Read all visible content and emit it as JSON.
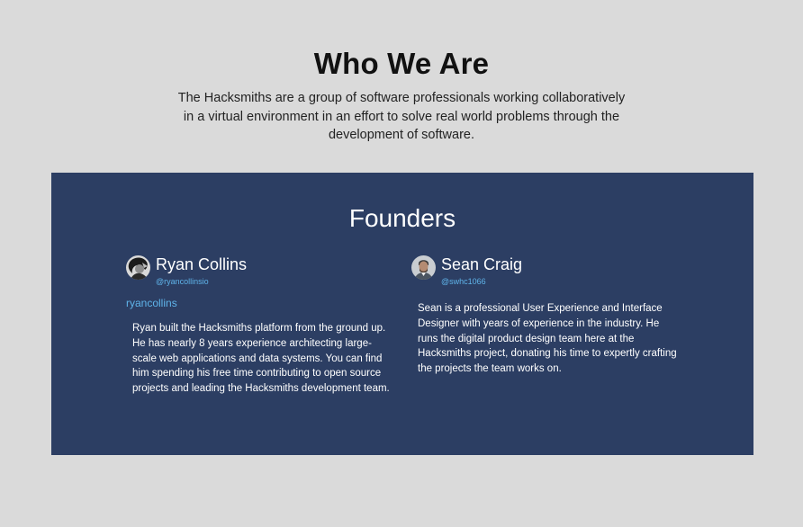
{
  "who": {
    "title": "Who We Are",
    "description": "The Hacksmiths are a group of software professionals working collaboratively in a virtual environment in an effort to solve real world problems through the development of software."
  },
  "founders": {
    "title": "Founders",
    "people": [
      {
        "name": "Ryan Collins",
        "handle": "@ryancollinsio",
        "link": "ryancollins",
        "bio": "Ryan built the Hacksmiths platform from the ground up. He has nearly 8 years experience architecting large-scale web applications and data systems. You can find him spending his free time contributing to open source projects and leading the Hacksmiths development team."
      },
      {
        "name": "Sean Craig",
        "handle": "@swhc1066",
        "bio": "Sean is a professional User Experience and Interface Designer with years of experience in the industry. He runs the digital product design team here at the Hacksmiths project, donating his time to expertly crafting the projects the team works on."
      }
    ]
  },
  "colors": {
    "page_bg": "#dadada",
    "panel_bg": "#2c3e63",
    "link": "#5fb4ea"
  }
}
